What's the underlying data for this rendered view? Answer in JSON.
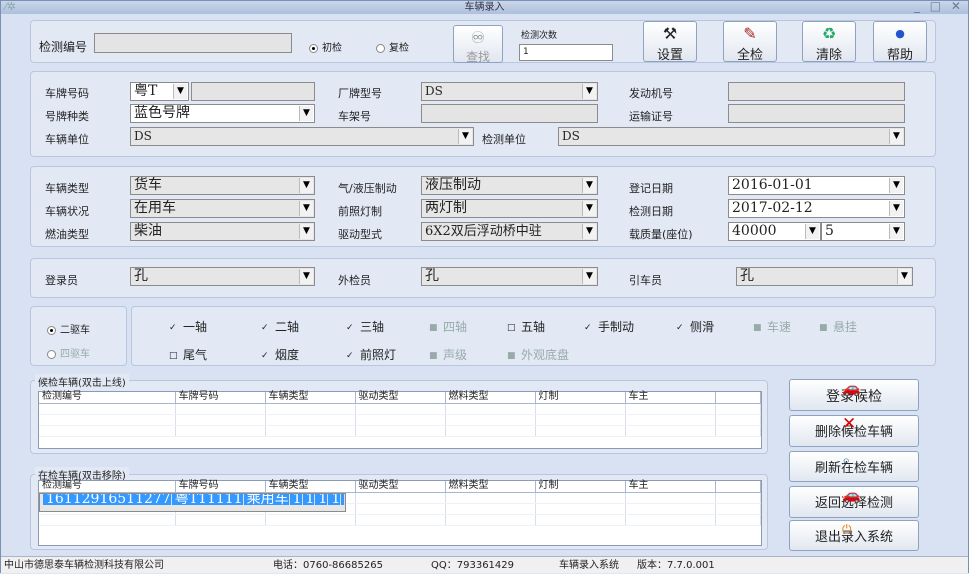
{
  "window": {
    "title": "车辆录入",
    "controls": "_ □ ✕"
  },
  "top": {
    "test_no_label": "检测编号",
    "radio_first": "初检",
    "radio_retest": "复检",
    "find_button": "查找",
    "count_label": "检测次数",
    "count_value": "1",
    "buttons": [
      {
        "label": "设置",
        "icon": "tools-icon"
      },
      {
        "label": "全检",
        "icon": "pen-icon"
      },
      {
        "label": "清除",
        "icon": "clear-icon"
      },
      {
        "label": "帮助",
        "icon": "help-icon"
      }
    ]
  },
  "vehicle": {
    "plate_no_label": "车牌号码",
    "plate_prefix": "粤T",
    "plate_type_label": "号牌种类",
    "plate_type": "蓝色号牌",
    "owner_label": "车辆单位",
    "owner": "DS",
    "model_label": "厂牌型号",
    "model": "DS",
    "vin_label": "车架号",
    "engine_label": "发动机号",
    "transport_label": "运输证号",
    "station_label": "检测单位",
    "station": "DS"
  },
  "specs": {
    "type_label": "车辆类型",
    "type": "货车",
    "status_label": "车辆状况",
    "status": "在用车",
    "fuel_label": "燃油类型",
    "fuel": "柴油",
    "brake_label": "气/液压制动",
    "brake": "液压制动",
    "lamp_label": "前照灯制",
    "lamp": "两灯制",
    "drive_label": "驱动型式",
    "drive": "6X2双后浮动桥中驻",
    "reg_date_label": "登记日期",
    "reg_date": "2016-01-01",
    "test_date_label": "检测日期",
    "test_date": "2017-02-12",
    "load_label": "载质量(座位)",
    "load": "40000",
    "seats": "5"
  },
  "staff": {
    "login_label": "登录员",
    "login": "孔",
    "inspector_label": "外检员",
    "inspector": "孔",
    "driver_label": "引车员",
    "driver": "孔"
  },
  "drive_mode": {
    "two": "二驱车",
    "four": "四驱车"
  },
  "checks": {
    "row1": [
      {
        "label": "一轴",
        "state": "checked"
      },
      {
        "label": "二轴",
        "state": "checked"
      },
      {
        "label": "三轴",
        "state": "checked"
      },
      {
        "label": "四轴",
        "state": "disabled"
      },
      {
        "label": "五轴",
        "state": "unchecked"
      },
      {
        "label": "手制动",
        "state": "checked"
      },
      {
        "label": "侧滑",
        "state": "checked"
      },
      {
        "label": "车速",
        "state": "disabled"
      },
      {
        "label": "悬挂",
        "state": "disabled"
      }
    ],
    "row2": [
      {
        "label": "尾气",
        "state": "unchecked"
      },
      {
        "label": "烟度",
        "state": "checked"
      },
      {
        "label": "前照灯",
        "state": "checked"
      },
      {
        "label": "声级",
        "state": "disabled"
      },
      {
        "label": "外观底盘",
        "state": "disabled"
      }
    ]
  },
  "waiting": {
    "title": "候检车辆(双击上线)",
    "columns": [
      "检测编号",
      "车牌号码",
      "车辆类型",
      "驱动类型",
      "燃料类型",
      "灯制",
      "车主"
    ]
  },
  "testing": {
    "title": "在检车辆(双击移除)",
    "columns": [
      "检测编号",
      "车牌号码",
      "车辆类型",
      "驱动类型",
      "燃料类型",
      "灯制",
      "车主"
    ],
    "rows": [
      [
        "16112916511277",
        "粤T11111",
        "乘用车",
        "1",
        "1",
        "1",
        "1"
      ]
    ]
  },
  "actions": [
    {
      "label": "登录候检",
      "icon": "car-icon"
    },
    {
      "label": "删除候检车辆",
      "icon": "delete-icon"
    },
    {
      "label": "刷新在检车辆",
      "icon": "magnifier-icon"
    },
    {
      "label": "返回选择检测",
      "icon": "car-icon"
    },
    {
      "label": "退出录入系统",
      "icon": "exit-icon"
    }
  ],
  "statusbar": {
    "company": "中山市德思泰车辆检测科技有限公司",
    "phone": "电话：0760-86685265",
    "qq": "QQ：793361429",
    "system": "车辆录入系统",
    "version": "版本：7.7.0.001"
  }
}
